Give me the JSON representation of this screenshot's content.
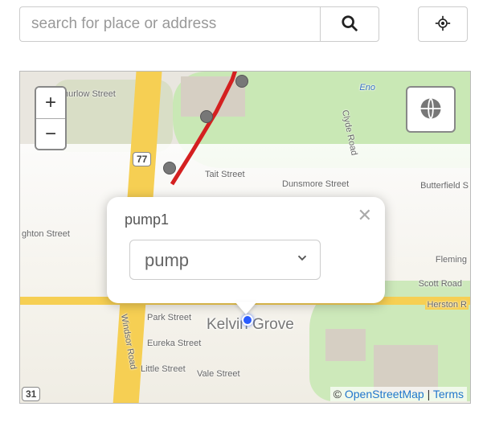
{
  "search": {
    "placeholder": "search for place or address",
    "value": ""
  },
  "zoom": {
    "in": "+",
    "out": "−"
  },
  "popup": {
    "title": "pump1",
    "selected": "pump"
  },
  "place_label": "Kelvin Grove",
  "streets": {
    "hurlow": "hurlow Street",
    "tait": "Tait Street",
    "dunsmore": "Dunsmore Street",
    "butterfield": "Butterfield S",
    "clyde": "Clyde Road",
    "fleming": "Fleming",
    "scott": "Scott Road",
    "herston": "Herston R",
    "ghton": "ghton Street",
    "park": "Park Street",
    "eureka": "Eureka Street",
    "little": "Little Street",
    "vale": "Vale Street",
    "windsor": "Windsor Road",
    "hwy_shield": "77",
    "hwy_shield2": "31",
    "eno": "Eno"
  },
  "attribution": {
    "prefix": "© ",
    "osm": "OpenStreetMap",
    "sep": " | ",
    "terms": "Terms"
  }
}
